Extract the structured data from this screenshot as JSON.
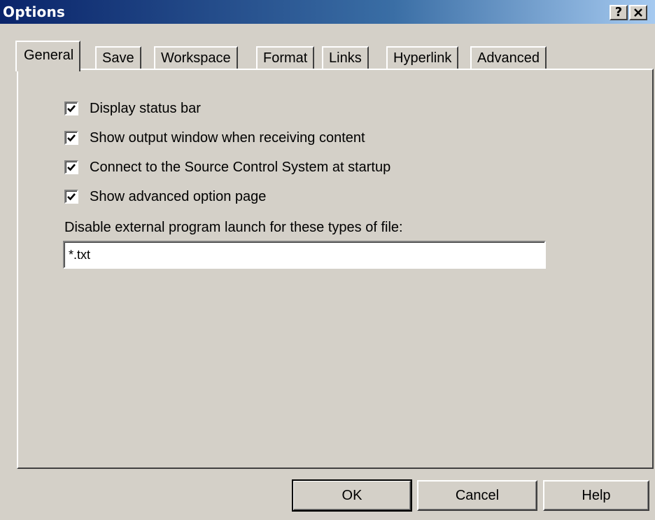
{
  "window": {
    "title": "Options",
    "help_button": "?",
    "close_button": "✕"
  },
  "tabs": [
    {
      "label": "General",
      "active": true
    },
    {
      "label": "Save"
    },
    {
      "label": "Workspace"
    },
    {
      "label": "Format"
    },
    {
      "label": "Links"
    },
    {
      "label": "Hyperlink"
    },
    {
      "label": "Advanced"
    }
  ],
  "general": {
    "checkboxes": [
      {
        "label": "Display status bar",
        "checked": true
      },
      {
        "label": "Show output window when receiving content",
        "checked": true
      },
      {
        "label": "Connect to the Source Control System at startup",
        "checked": true
      },
      {
        "label": "Show advanced option page",
        "checked": true
      }
    ],
    "disable_launch_label": "Disable external program launch for these types of file:",
    "disable_launch_value": "*.txt"
  },
  "buttons": {
    "ok": "OK",
    "cancel": "Cancel",
    "help": "Help"
  }
}
